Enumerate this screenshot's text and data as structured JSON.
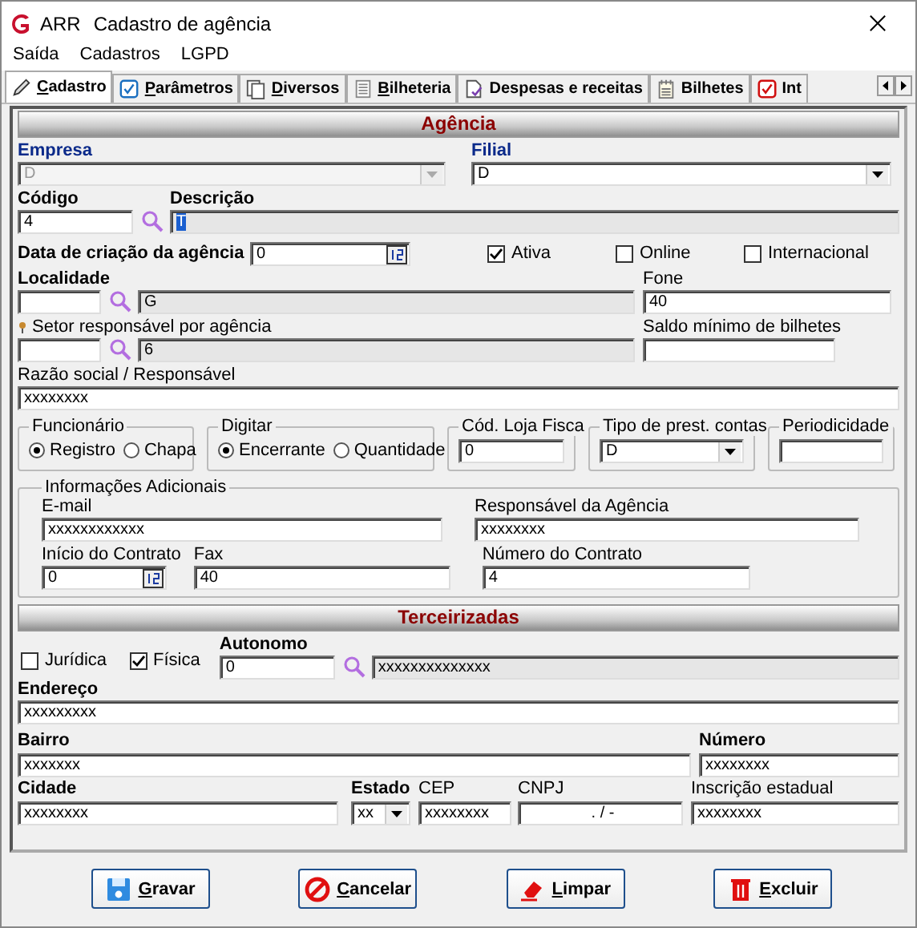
{
  "window": {
    "app": "ARR",
    "title": "Cadastro de agência"
  },
  "menu": [
    "Saída",
    "Cadastros",
    "LGPD"
  ],
  "tabs": [
    {
      "label": "Cadastro",
      "kind": "pencil",
      "accel": true,
      "selected": true
    },
    {
      "label": "Parâmetros",
      "kind": "check",
      "accel": true,
      "selected": false
    },
    {
      "label": "Diversos",
      "kind": "pages",
      "accel": true,
      "selected": false
    },
    {
      "label": "Bilheteria",
      "kind": "doc",
      "accel": true,
      "selected": false
    },
    {
      "label": "Despesas e receitas",
      "kind": "doccheck",
      "accel": false,
      "selected": false
    },
    {
      "label": "Bilhetes",
      "kind": "notepad",
      "accel": false,
      "selected": false
    },
    {
      "label": "Int",
      "kind": "redcheck",
      "accel": false,
      "selected": false
    }
  ],
  "agencia": {
    "heading": "Agência",
    "empresa": {
      "label": "Empresa",
      "value": "D",
      "disabled": true
    },
    "filial": {
      "label": "Filial",
      "value": "D",
      "disabled": false
    },
    "codigo": {
      "label": "Código",
      "value": "4"
    },
    "descricao": {
      "label": "Descrição",
      "value": "T",
      "highlighted": true
    },
    "data_criacao": {
      "label": "Data de criação da agência",
      "value": "0"
    },
    "flags": [
      {
        "label": "Ativa",
        "checked": true
      },
      {
        "label": "Online",
        "checked": false
      },
      {
        "label": "Internacional",
        "checked": false
      }
    ],
    "localidade": {
      "label": "Localidade",
      "description": "G"
    },
    "fone": {
      "label": "Fone",
      "value": "40"
    },
    "setor": {
      "label": "Setor responsável por agência",
      "description": "6"
    },
    "saldo": {
      "label": "Saldo mínimo de bilhetes"
    },
    "razao": {
      "label": "Razão social / Responsável",
      "value": "xxxxxxxx"
    },
    "funcionario": {
      "label": "Funcionário",
      "options": [
        {
          "label": "Registro",
          "selected": true
        },
        {
          "label": "Chapa",
          "selected": false
        }
      ]
    },
    "digitar": {
      "label": "Digitar",
      "options": [
        {
          "label": "Encerrante",
          "selected": true
        },
        {
          "label": "Quantidade",
          "selected": false
        }
      ]
    },
    "cod_loja": {
      "label": "Cód. Loja Fisca",
      "value": "0"
    },
    "tipo_prest": {
      "label": "Tipo de prest. contas",
      "value": "D"
    },
    "periodicidade": {
      "label": "Periodicidade"
    },
    "info": {
      "label": "Informações Adicionais",
      "email": {
        "label": "E-mail",
        "value": "xxxxxxxxxxxx"
      },
      "responsavel": {
        "label": "Responsável da Agência",
        "value": "xxxxxxxx"
      },
      "inicio": {
        "label": "Início do Contrato",
        "value": "0"
      },
      "fax": {
        "label": "Fax",
        "value": "40"
      },
      "numero_contrato": {
        "label": "Número do Contrato",
        "value": "4"
      }
    }
  },
  "terceirizadas": {
    "heading": "Terceirizadas",
    "tipos": [
      {
        "label": "Jurídica",
        "checked": false
      },
      {
        "label": "Física",
        "checked": true
      }
    ],
    "autonomo": {
      "label": "Autonomo",
      "value": "0",
      "description": "xxxxxxxxxxxxxx"
    },
    "endereco": {
      "label": "Endereço",
      "value": "xxxxxxxxx"
    },
    "bairro": {
      "label": "Bairro",
      "value": "xxxxxxx"
    },
    "numero": {
      "label": "Número",
      "value": "xxxxxxxx"
    },
    "cidade": {
      "label": "Cidade",
      "value": "xxxxxxxx"
    },
    "estado": {
      "label": "Estado",
      "value": "xx"
    },
    "cep": {
      "label": "CEP",
      "value": "xxxxxxxx"
    },
    "cnpj": {
      "label": "CNPJ",
      "value": ". / -"
    },
    "inscricao": {
      "label": "Inscrição estadual",
      "value": "xxxxxxxx"
    }
  },
  "buttons": [
    {
      "label": "Gravar",
      "kind": "save"
    },
    {
      "label": "Cancelar",
      "kind": "cancel"
    },
    {
      "label": "Limpar",
      "kind": "eraser"
    },
    {
      "label": "Excluir",
      "kind": "trash"
    }
  ]
}
